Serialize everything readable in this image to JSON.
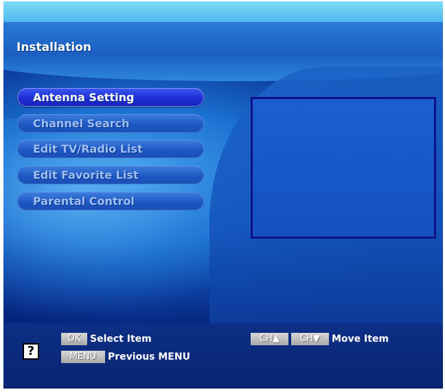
{
  "header": {
    "title": "Installation"
  },
  "menu": {
    "items": [
      {
        "label": "Antenna Setting",
        "selected": true
      },
      {
        "label": "Channel Search",
        "selected": false
      },
      {
        "label": "Edit TV/Radio List",
        "selected": false
      },
      {
        "label": "Edit Favorite List",
        "selected": false
      },
      {
        "label": "Parental Control",
        "selected": false
      }
    ]
  },
  "footer": {
    "help_icon_glyph": "?",
    "ok_key": "OK",
    "ok_hint": "Select Item",
    "menu_key": "MENU",
    "menu_hint": "Previous MENU",
    "ch_up_key": "CH▲",
    "ch_down_key": "CH▼",
    "move_hint": "Move Item"
  },
  "colors": {
    "accent_selected": "#1e2fd6",
    "background": "#1a6fd0",
    "preview_border": "#0e0f86"
  }
}
